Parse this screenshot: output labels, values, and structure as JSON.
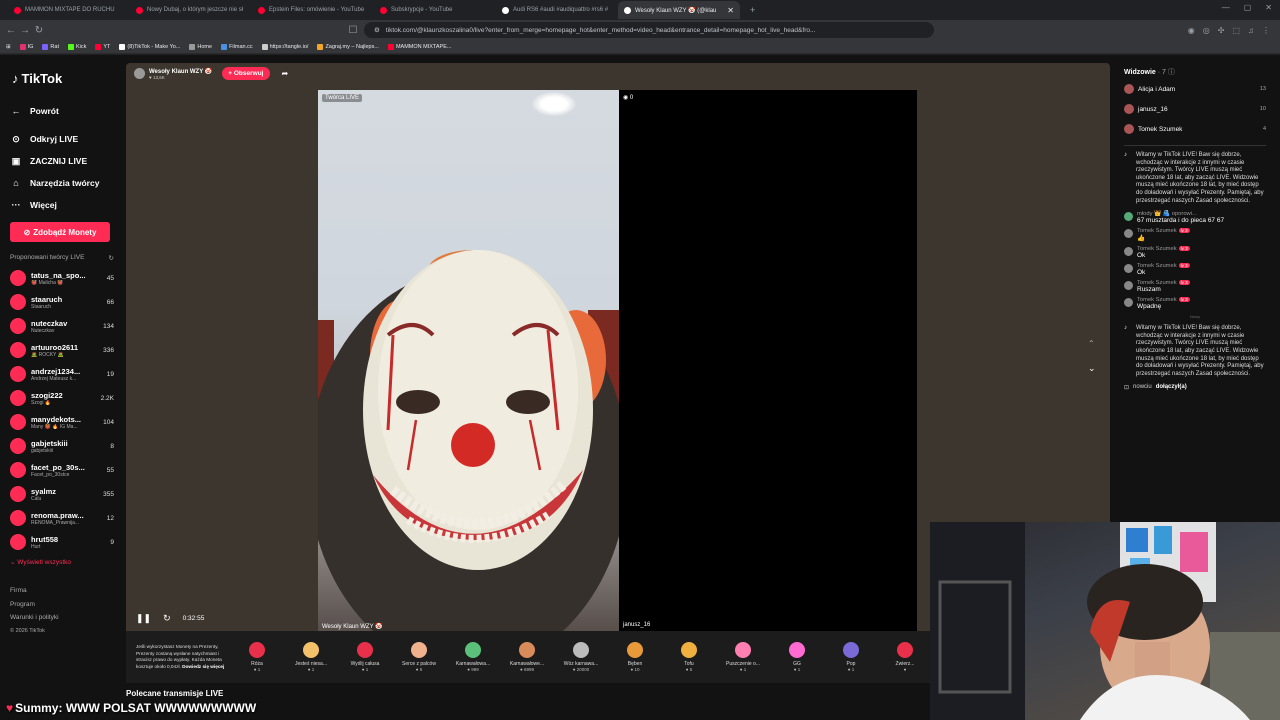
{
  "browser": {
    "tabs": [
      {
        "label": "MAMMON MIXTAPE DO RUCHU",
        "active": false
      },
      {
        "label": "Nowy Dubaj, o którym jeszcze nie sł",
        "active": false
      },
      {
        "label": "Epstein Files: omówienie - YouTube",
        "active": false
      },
      {
        "label": "Subskrypcje - YouTube",
        "active": false
      },
      {
        "label": "Audi RS6 #audi #audiquattro #rs6 #",
        "active": false
      },
      {
        "label": "Wesoły Klaun WZY 🤡 (@klau",
        "active": true
      }
    ],
    "new_tab": "+",
    "url": "tiktok.com/@klaunzkoszalina0/live?enter_from_merge=homepage_hot&enter_method=video_head&entrance_detail=homepage_hot_live_head&fro...",
    "bookmarks": [
      "IG",
      "Rat",
      "Kick",
      "YT",
      "(8)TikTok - Make Yo...",
      "Home",
      "Filman.cc",
      "https://tangle.io/",
      "Zagraj.my – Najleps...",
      "MAMMON MIXTAPE..."
    ]
  },
  "sidebar": {
    "logo": "TikTok",
    "back": "Powrót",
    "nav": [
      {
        "icon": "compass-icon",
        "glyph": "⊙",
        "label": "Odkryj LIVE"
      },
      {
        "icon": "live-icon",
        "glyph": "▣",
        "label": "ZACZNIJ LIVE"
      },
      {
        "icon": "tools-icon",
        "glyph": "⌂",
        "label": "Narzędzia twórcy"
      },
      {
        "icon": "more-icon",
        "glyph": "···",
        "label": "Więcej"
      }
    ],
    "coins_button": "Zdobądź Monety",
    "suggested_title": "Proponowani twórcy LIVE",
    "creators": [
      {
        "name": "tatus_na_spo...",
        "sub": "👹 Malicha 👹",
        "count": "45"
      },
      {
        "name": "staaruch",
        "sub": "Staaruch",
        "count": "66"
      },
      {
        "name": "nuteczkav",
        "sub": "Nuteczkav",
        "count": "134"
      },
      {
        "name": "artuuroo2611",
        "sub": "🧟 ROCKY 🧟",
        "count": "336"
      },
      {
        "name": "andrzej1234...",
        "sub": "Andrzej Mateusz k...",
        "count": "19"
      },
      {
        "name": "szogi222",
        "sub": "Szogi 🔥",
        "count": "2.2K"
      },
      {
        "name": "manydekots...",
        "sub": "Many 👹 🔥 IG Ma...",
        "count": "104"
      },
      {
        "name": "gabjetskiii",
        "sub": "gabjetskiii",
        "count": "8"
      },
      {
        "name": "facet_po_30s...",
        "sub": "Facet_po_30stce",
        "count": "55"
      },
      {
        "name": "syalmz",
        "sub": "Calu",
        "count": "355"
      },
      {
        "name": "renoma.praw...",
        "sub": "RENOMA_Prawnija...",
        "count": "12"
      },
      {
        "name": "hrut558",
        "sub": "Hurt",
        "count": "9"
      }
    ],
    "show_all": "Wyświetl wszystko",
    "footer": [
      "Firma",
      "Program",
      "Warunki i polityki"
    ],
    "copyright": "© 2026 TikTok"
  },
  "live": {
    "host_name": "Wesoły Klaun WZY 🤡",
    "host_views": "13,6K",
    "follow": "+ Obserwuj",
    "creator_tag": "Twórca LIVE",
    "guest_viewers": "0",
    "host_label": "Wesoły Klaun WZY 🤡",
    "guest_label": "janusz_16",
    "time": "0:32:55"
  },
  "gifts": {
    "info_text": "Jeśli wykorzystasz Monety na Prezenty, Prezenty zostaną wysłane natychmiast i stracisz prawo do wypłaty. Każda Moneta kosztuje około 0,04zł.",
    "info_link": "Dowiedz się więcej",
    "items": [
      {
        "name": "Róża",
        "price": "1",
        "color": "#e8304a"
      },
      {
        "name": "Jesteś niesa...",
        "price": "1",
        "color": "#f2c16a"
      },
      {
        "name": "Wyślij całusa",
        "price": "1",
        "color": "#e8304a"
      },
      {
        "name": "Serce z palców",
        "price": "5",
        "color": "#f0b28c"
      },
      {
        "name": "Karnawałowa...",
        "price": "999",
        "color": "#5ac07a"
      },
      {
        "name": "Karnawałowe...",
        "price": "6999",
        "color": "#d98c5a"
      },
      {
        "name": "Wóz karnawa...",
        "price": "20000",
        "color": "#bbb"
      },
      {
        "name": "Bęben",
        "price": "10",
        "color": "#e89a3a"
      },
      {
        "name": "Tofu",
        "price": "5",
        "color": "#f0b040"
      },
      {
        "name": "Puszczenie o...",
        "price": "1",
        "color": "#ff7fb0"
      },
      {
        "name": "GG",
        "price": "1",
        "color": "#ff6bd0"
      },
      {
        "name": "Pop",
        "price": "1",
        "color": "#7a6ad8"
      },
      {
        "name": "Zwierz...",
        "price": "",
        "color": "#e8304a"
      }
    ]
  },
  "recommended": "Polecane transmisje LIVE",
  "viewers_panel": {
    "title": "Widzowie",
    "count": "· 7",
    "list": [
      {
        "name": "Alicja i Adam",
        "count": "13"
      },
      {
        "name": "janusz_16",
        "count": "10"
      },
      {
        "name": "Tomek Szumek",
        "count": "4"
      }
    ],
    "system_message": "Witamy w TikTok LIVE! Baw się dobrze, wchodząc w interakcje z innymi w czasie rzeczywistym. Twórcy LIVE muszą mieć ukończone 18 lat, aby zacząć LIVE. Widzowie muszą mieć ukończone 18 lat, by mieć dostęp do doładowań i wysyłać Prezenty. Pamiętaj, aby przestrzegać naszych Zasad społeczności.",
    "first_comment": {
      "user": "młody 👑 🫂 oporowi...",
      "text": "67 musztarda i do pieca 67 67"
    },
    "comments": [
      {
        "user": "Tomek Szumek",
        "level": "lv 3",
        "text": "👍"
      },
      {
        "user": "Tomek Szumek",
        "level": "lv 3",
        "text": "Ok"
      },
      {
        "user": "Tomek Szumek",
        "level": "lv 3",
        "text": "Ok"
      },
      {
        "user": "Tomek Szumek",
        "level": "lv 3",
        "text": "Ruszam"
      },
      {
        "user": "Tomek Szumek",
        "level": "lv 3",
        "text": "Wpadnę"
      }
    ],
    "sep": "Nowy",
    "joined_user": "nowciu",
    "joined_text": "dołączył(a)"
  },
  "ticker": {
    "user": "Summy",
    "text": ": WWW POLSAT WWWWWWWWW"
  }
}
